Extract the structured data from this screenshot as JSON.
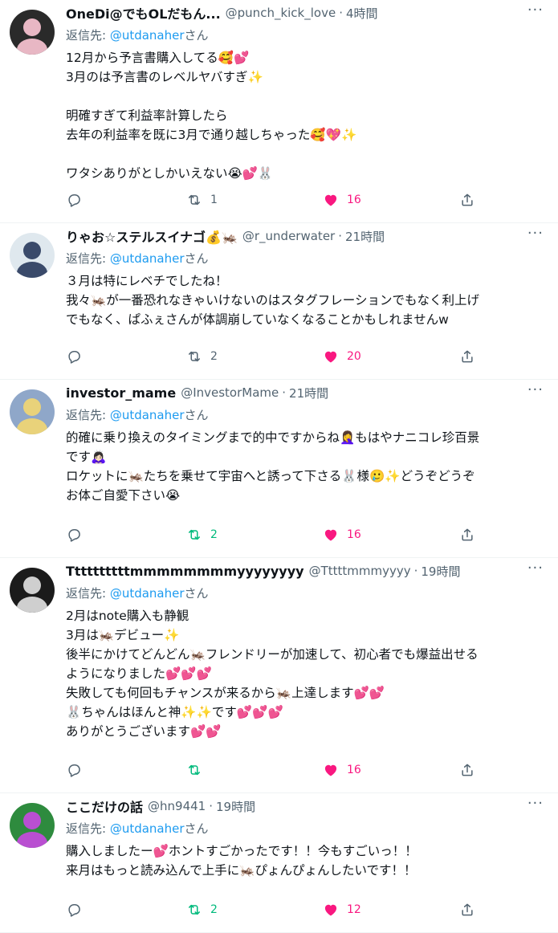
{
  "tweets": [
    {
      "name": "OneDi@でもOLだもん...",
      "handle": "@punch_kick_love",
      "dot": "·",
      "time": "4時間",
      "replying_label": "返信先: ",
      "replying_mention": "@utdanaher",
      "replying_suffix": "さん",
      "lines": [
        "12月から予言書購入してる🥰💕",
        "3月のは予言書のレベルヤバすぎ✨",
        "",
        "明確すぎて利益率計算したら",
        "去年の利益率を既に3月で通り越しちゃった🥰💖✨",
        "",
        "ワタシありがとしかいえない😭💕🐰"
      ],
      "reply_count": "",
      "retweet_count": "1",
      "like_count": "16",
      "liked": true,
      "retweeted": false
    },
    {
      "name": "りゃお☆ステルスイナゴ💰🦗",
      "handle": "@r_underwater",
      "dot": "·",
      "time": "21時間",
      "replying_label": "返信先: ",
      "replying_mention": "@utdanaher",
      "replying_suffix": "さん",
      "lines": [
        "３月は特にレベチでしたね！",
        "我々🦗が一番恐れなきゃいけないのはスタグフレーションでもなく利上げ",
        "でもなく、ぱふぇさんが体調崩していなくなることかもしれませんw"
      ],
      "reply_count": "",
      "retweet_count": "2",
      "like_count": "20",
      "liked": true,
      "retweeted": false
    },
    {
      "name": "investor_mame",
      "handle": "@InvestorMame",
      "dot": "·",
      "time": "21時間",
      "replying_label": "返信先: ",
      "replying_mention": "@utdanaher",
      "replying_suffix": "さん",
      "lines": [
        "的確に乗り換えのタイミングまで的中ですからね🤦‍♀️もはやナニコレ珍百景",
        "です🙇🏻‍♀️",
        "ロケットに🦗たちを乗せて宇宙へと誘って下さる🐰様🥲✨どうぞどうぞ",
        "お体ご自愛下さい😭"
      ],
      "reply_count": "",
      "retweet_count": "2",
      "like_count": "16",
      "liked": true,
      "retweeted": true
    },
    {
      "name": "Ttttttttttmmmmmmmmyyyyyyyy",
      "handle": "@Tttttmmmyyyy",
      "dot": "·",
      "time": "19時間",
      "replying_label": "返信先: ",
      "replying_mention": "@utdanaher",
      "replying_suffix": "さん",
      "lines": [
        "2月はnote購入も静観",
        "3月は🦗デビュー✨",
        "後半にかけてどんどん🦗フレンドリーが加速して、初心者でも爆益出せる",
        "ようになりました💕💕💕",
        "失敗しても何回もチャンスが来るから🦗上達します💕💕",
        "🐰ちゃんはほんと神✨✨です💕💕💕",
        "ありがとうございます💕💕"
      ],
      "reply_count": "",
      "retweet_count": "",
      "like_count": "16",
      "liked": true,
      "retweeted": true
    },
    {
      "name": "ここだけの話",
      "handle": "@hn9441",
      "dot": "·",
      "time": "19時間",
      "replying_label": "返信先: ",
      "replying_mention": "@utdanaher",
      "replying_suffix": "さん",
      "lines": [
        "購入しましたー💕ホントすごかったです！！今もすごいっ！！",
        "来月はもっと読み込んで上手に🦗ぴょんぴょんしたいです！！"
      ],
      "reply_count": "",
      "retweet_count": "2",
      "like_count": "12",
      "liked": true,
      "retweeted": true
    }
  ],
  "colors": {
    "accent": "#1d9bf0",
    "like": "#f91880",
    "retweet": "#00ba7c",
    "muted": "#536471"
  },
  "icons": {
    "more": "more-icon",
    "reply": "reply-icon",
    "retweet": "retweet-icon",
    "like": "heart-icon",
    "share": "share-icon"
  }
}
